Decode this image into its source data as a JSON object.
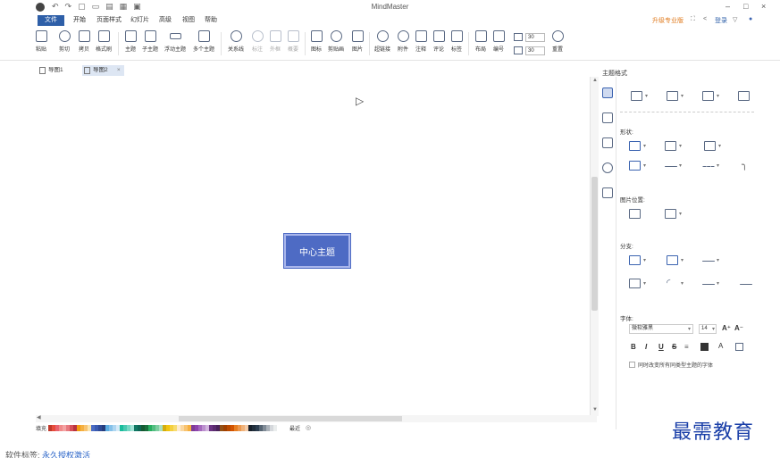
{
  "app": {
    "title": "MindMaster"
  },
  "window": {
    "minimize": "–",
    "maximize": "□",
    "close": "×"
  },
  "menu": {
    "file": "文件",
    "items": [
      "开始",
      "页面样式",
      "幻灯片",
      "高级",
      "视图",
      "帮助"
    ],
    "upgrade": "升级专业版",
    "login": "登录"
  },
  "ribbon": {
    "buttons": [
      "粘贴",
      "剪切",
      "拷贝",
      "格式刷",
      "主题",
      "子主题",
      "浮动主题",
      "多个主题",
      "关系线",
      "标注",
      "外框",
      "概要",
      "图标",
      "剪贴画",
      "图片",
      "超链接",
      "附件",
      "注释",
      "评论",
      "标签",
      "布局",
      "编号",
      "重置"
    ],
    "spin1": "30",
    "spin2": "30"
  },
  "tabs": [
    {
      "label": "导图1"
    },
    {
      "label": "导图2"
    }
  ],
  "canvas": {
    "central_topic": "中心主题"
  },
  "palette": {
    "label": "填充",
    "right_label": "最近"
  },
  "palette_colors": [
    "#c0392b",
    "#e74c3c",
    "#e8636f",
    "#f08a8a",
    "#f4a3a3",
    "#e7797f",
    "#d6505a",
    "#b83340",
    "#f39c12",
    "#f5b041",
    "#f8c471",
    "#fae5b0",
    "#4a6bc4",
    "#3a5bb0",
    "#2f4a96",
    "#263d7d",
    "#5dade2",
    "#85c1e9",
    "#aed6f1",
    "#d6eaf8",
    "#1abc9c",
    "#48c9b0",
    "#76d7c4",
    "#a3e4d7",
    "#117864",
    "#0e6655",
    "#145a32",
    "#196f3d",
    "#27ae60",
    "#52be80",
    "#7dcea0",
    "#a9dfbf",
    "#d4ac0d",
    "#f1c40f",
    "#f4d03f",
    "#f7dc6f",
    "#fdebd0",
    "#fad7a0",
    "#f8c471",
    "#f5b041",
    "#7d3c98",
    "#8e44ad",
    "#a569bd",
    "#bb8fce",
    "#d2b4de",
    "#6c3483",
    "#5b2c6f",
    "#4a235a",
    "#935116",
    "#a04000",
    "#ba4a00",
    "#d35400",
    "#e67e22",
    "#eb984e",
    "#f0b27a",
    "#f5cba7",
    "#17202a",
    "#212f3c",
    "#2c3e50",
    "#566573",
    "#808b96",
    "#abb2b9",
    "#d5d8dc",
    "#eaeded"
  ],
  "panel": {
    "title": "主题格式",
    "shape_label": "形状:",
    "image_pos_label": "图片位置:",
    "branch_label": "分支:",
    "font_label": "字体:",
    "font_name": "微软雅黑",
    "font_size": "14",
    "format_buttons": [
      "B",
      "I",
      "U",
      "S"
    ],
    "grow": "A⁺",
    "shrink": "A⁻",
    "checkbox_label": "同时改变所有同类型主题的字体"
  },
  "watermark": "最需教育",
  "footer": {
    "label": "软件标签:",
    "link": "永久授权激活"
  }
}
